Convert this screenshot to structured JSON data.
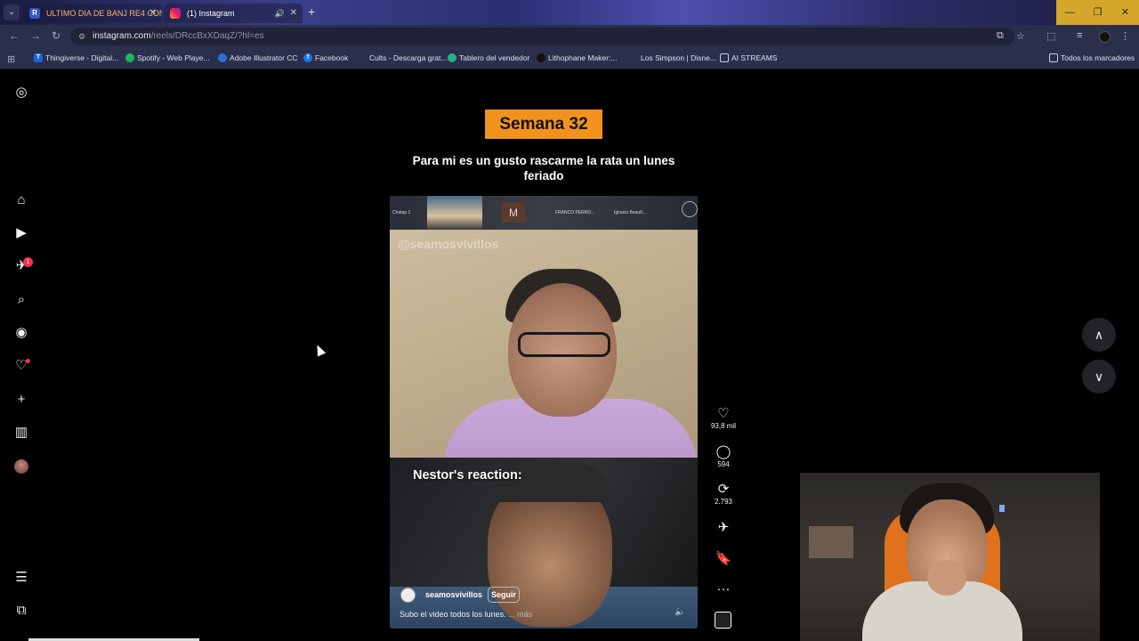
{
  "browser": {
    "tabs": [
      {
        "label": "ULTIMO DIA DE BANJ RE4 CON",
        "favicon": "R"
      },
      {
        "label": "(1) Instagram"
      }
    ],
    "url_host": "instagram.com",
    "url_path": "/reels/DRccBxXDaqZ/?hl=es",
    "bookmarks": [
      {
        "label": "Thingiverse - Digital...",
        "icon_letter": "T",
        "color": "#1e64d6"
      },
      {
        "label": "Spotify - Web Playe...",
        "icon_letter": "",
        "color": "#1db954"
      },
      {
        "label": "Adobe Illustrator CC",
        "icon_letter": "",
        "color": "#2a6fdb"
      },
      {
        "label": "Facebook",
        "icon_letter": "f",
        "color": "#1877f2"
      },
      {
        "label": "Cults - Descarga grat...",
        "icon_letter": "",
        "color": "#2b2f4c"
      },
      {
        "label": "Tablero del vendedor",
        "icon_letter": "",
        "color": "#24b47e"
      },
      {
        "label": "Lithophane Maker:...",
        "icon_letter": "",
        "color": "#111111"
      },
      {
        "label": "Los Simpson | Disne...",
        "icon_letter": "",
        "color": "#2b2f4c"
      },
      {
        "label": "AI STREAMS",
        "icon_letter": "",
        "color": "#2b2f4c"
      }
    ],
    "all_bookmarks": "Todos los marcadores"
  },
  "sidebar": {
    "notification_count": "1"
  },
  "reel": {
    "week_label": "Semana 32",
    "top_caption": "Para mi es un gusto rascarme la rata un lunes feriado",
    "watermark": "@seamosvivillos",
    "zoom_labels": [
      "Chatap 1",
      "M",
      "FRANCO PERRO...",
      "Ignacio Beaufi..."
    ],
    "reaction_text": "Nestor's reaction:",
    "author": "seamosvivillos",
    "follow_label": "Seguir",
    "description": "Subo el video todos los lunes.",
    "more_label": "... más"
  },
  "actions": {
    "likes": "93,8 mil",
    "comments": "594",
    "reposts": "2.793"
  }
}
